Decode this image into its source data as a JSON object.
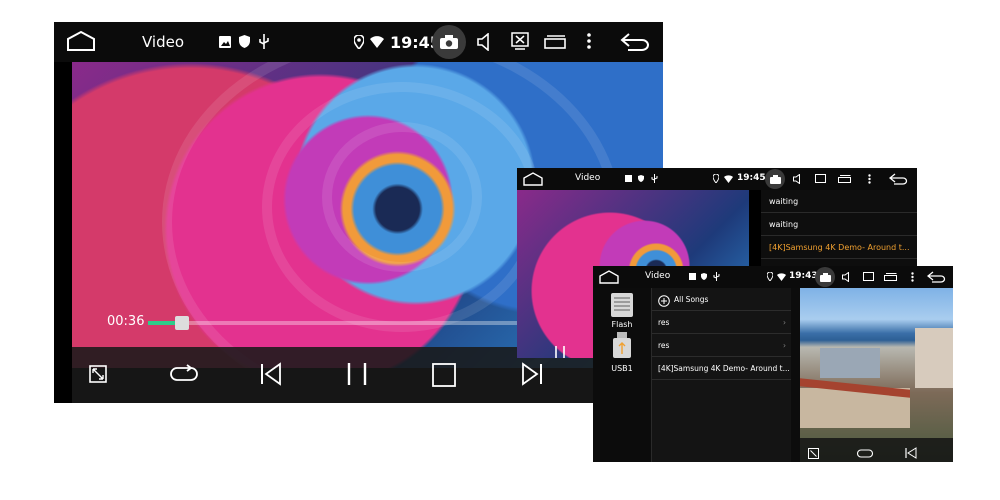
{
  "screen_main": {
    "title": "Video",
    "time": "19:45",
    "elapsed": "00:36",
    "progress_fraction": 0.09,
    "icons": [
      "home-icon",
      "image-icon",
      "shield-icon",
      "usb-icon",
      "location-icon",
      "wifi-icon",
      "camera-icon",
      "volume-icon",
      "screen-off-icon",
      "window-icon",
      "menu-icon",
      "back-icon"
    ],
    "controls": [
      "fullscreen-icon",
      "repeat-icon",
      "previous-icon",
      "pause-icon",
      "stop-icon",
      "next-icon"
    ]
  },
  "screen_mid": {
    "title": "Video",
    "time": "19:45",
    "playlist": [
      {
        "label": "waiting",
        "color": "#ffffff"
      },
      {
        "label": "waiting",
        "color": "#ffffff"
      },
      {
        "label": "[4K]Samsung 4K Demo- Around t...",
        "color": "#f0a030"
      }
    ]
  },
  "screen_small": {
    "title": "Video",
    "time": "19:43",
    "sources": [
      {
        "label": "Flash"
      },
      {
        "label": "USB1"
      }
    ],
    "all_songs": "All Songs",
    "files": [
      {
        "label": "res"
      },
      {
        "label": "res"
      },
      {
        "label": "[4K]Samsung 4K Demo- Around t..."
      }
    ]
  },
  "colors": {
    "accent_green": "#2ecc8a",
    "highlight_orange": "#f0a030",
    "bar_bg": "#0b0b0b"
  }
}
